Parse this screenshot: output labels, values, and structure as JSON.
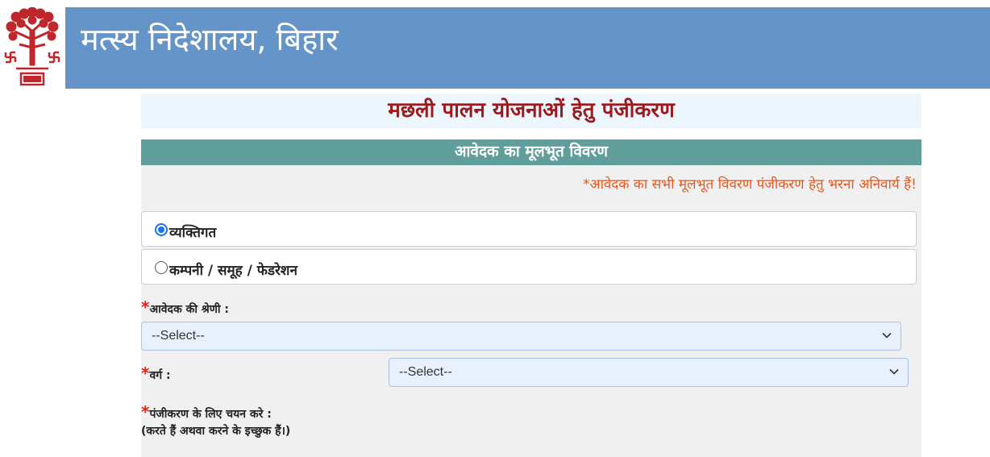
{
  "header": {
    "site_title": "मत्स्य निदेशालय, बिहार",
    "logo_icon": "bihar-government-emblem-icon",
    "background_color": "#6594c9"
  },
  "page": {
    "title": "मछली पालन योजनाओं हेतु पंजीकरण",
    "title_color": "#9c1a1c"
  },
  "section": {
    "title": "आवेदक का मूलभूत विवरण",
    "header_color": "#5f9e9b",
    "required_note": "*आवेदक का सभी मूलभूत विवरण पंजीकरण हेतु भरना अनिवार्य हैं!"
  },
  "applicant_type": {
    "options": [
      {
        "label": "व्यक्तिगत",
        "selected": true
      },
      {
        "label": "कम्पनी / समूह / फेडरेशन",
        "selected": false
      }
    ]
  },
  "fields": {
    "category": {
      "required_mark": "*",
      "label": "आवेदक की श्रेणी :",
      "value": "--Select--"
    },
    "varg": {
      "required_mark": "*",
      "label": "वर्ग :",
      "value": "--Select--"
    },
    "registration_choice": {
      "required_mark": "*",
      "label": "पंजीकरण के लिए चयन करे :",
      "sub_label": "(करते हैं अथवा करने के इच्छुक हैं।)"
    }
  }
}
